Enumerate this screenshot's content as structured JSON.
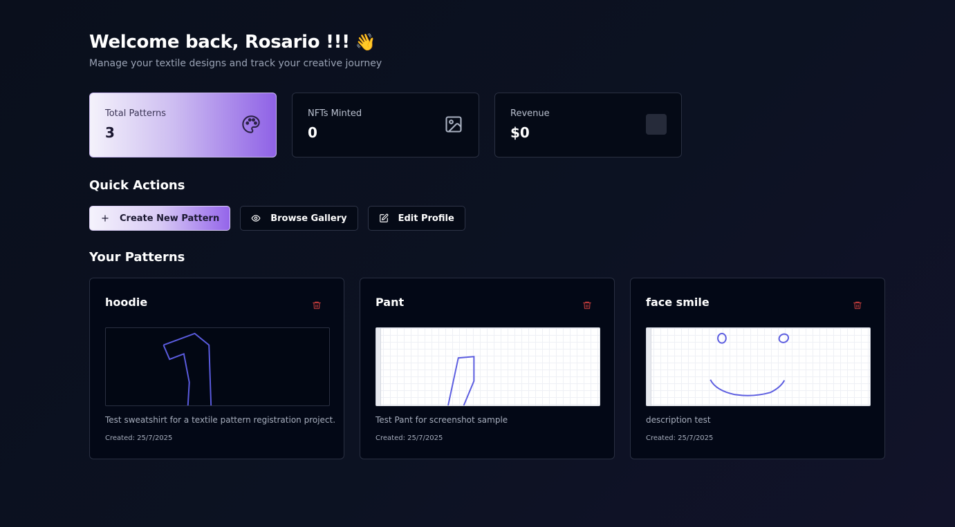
{
  "header": {
    "welcome_text": "Welcome back, Rosario !!!",
    "welcome_emoji": "👋",
    "subtitle": "Manage your textile designs and track your creative journey"
  },
  "stats": [
    {
      "label": "Total Patterns",
      "value": "3",
      "icon": "palette-icon"
    },
    {
      "label": "NFTs Minted",
      "value": "0",
      "icon": "image-icon"
    },
    {
      "label": "Revenue",
      "value": "$0",
      "icon": "placeholder-square"
    }
  ],
  "quick_actions": {
    "title": "Quick Actions",
    "buttons": [
      {
        "label": "Create New Pattern",
        "icon": "plus-icon"
      },
      {
        "label": "Browse Gallery",
        "icon": "eye-icon"
      },
      {
        "label": "Edit Profile",
        "icon": "edit-icon"
      }
    ]
  },
  "patterns": {
    "title": "Your Patterns",
    "items": [
      {
        "name": "hoodie",
        "description": "Test sweatshirt for a textile pattern registration project.",
        "created": "Created: 25/7/2025",
        "preview_style": "dark"
      },
      {
        "name": "Pant",
        "description": "Test Pant for screenshot sample",
        "created": "Created: 25/7/2025",
        "preview_style": "light"
      },
      {
        "name": "face smile",
        "description": "description test",
        "created": "Created: 25/7/2025",
        "preview_style": "light"
      }
    ]
  },
  "colors": {
    "accent_purple": "#8f62e6",
    "stroke_blue": "#5b5ce0",
    "trash_red": "#b93a3a"
  }
}
